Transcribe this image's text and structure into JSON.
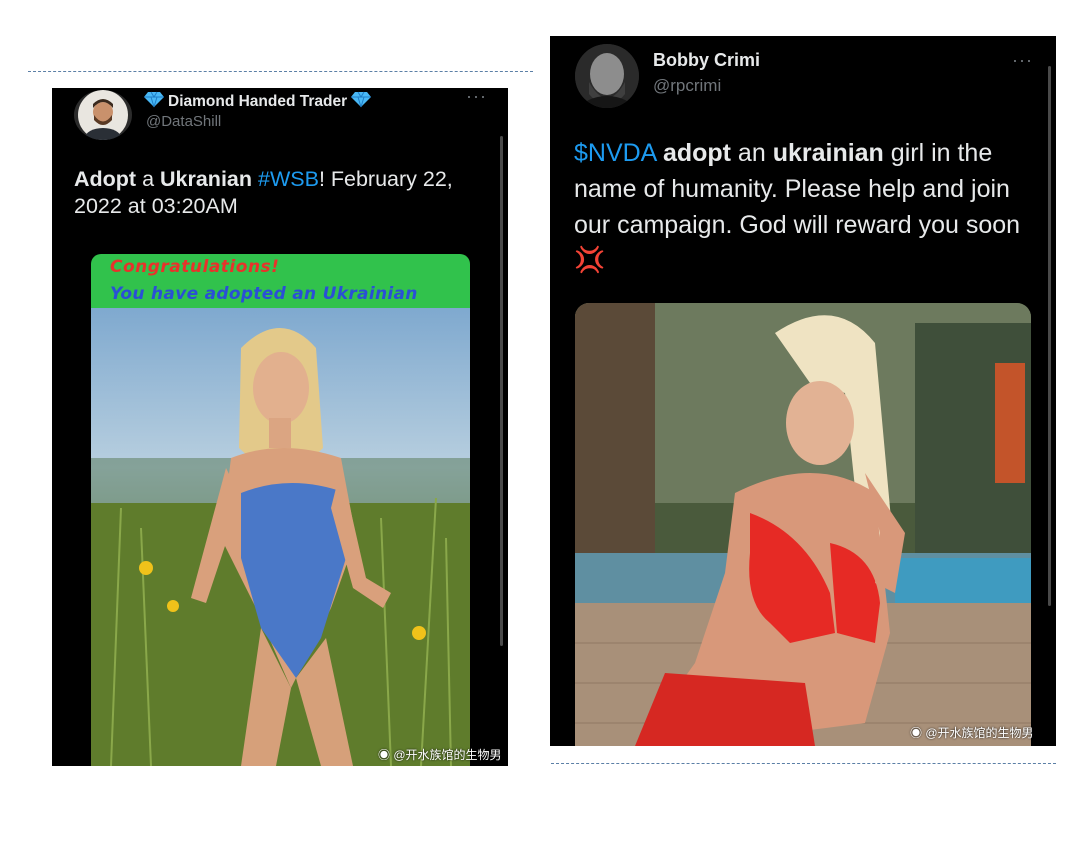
{
  "left_tweet": {
    "display_name": "Diamond Handed Trader",
    "handle": "@DataShill",
    "more": "···",
    "text_parts": {
      "w1": "Adopt",
      "w2": " a ",
      "w3": "Ukranian",
      "w4": " ",
      "hashtag": "#WSB",
      "w5": "! February 22, 2022 at 03:20AM"
    },
    "banner_line1": "Congratulations!",
    "banner_line2": "You have adopted an Ukrainian",
    "watermark": "@开水族馆的生物男"
  },
  "right_tweet": {
    "display_name": "Bobby Crimi",
    "handle": "@rpcrimi",
    "more": "···",
    "text_parts": {
      "cashtag": "$NVDA",
      "w1": " ",
      "w2": "adopt",
      "w3": " an ",
      "w4": "ukrainian",
      "w5": " girl in the name of humanity. Please help and join our campaign. God will reward you soon "
    },
    "emoji": "💢",
    "watermark": "@开水族馆的生物男"
  },
  "colors": {
    "card_bg": "#000000",
    "link_blue": "#1d9bf0",
    "banner_green": "#2fbf4a",
    "banner_red_text": "#e8322b",
    "banner_blue_text": "#2a4fd6"
  }
}
